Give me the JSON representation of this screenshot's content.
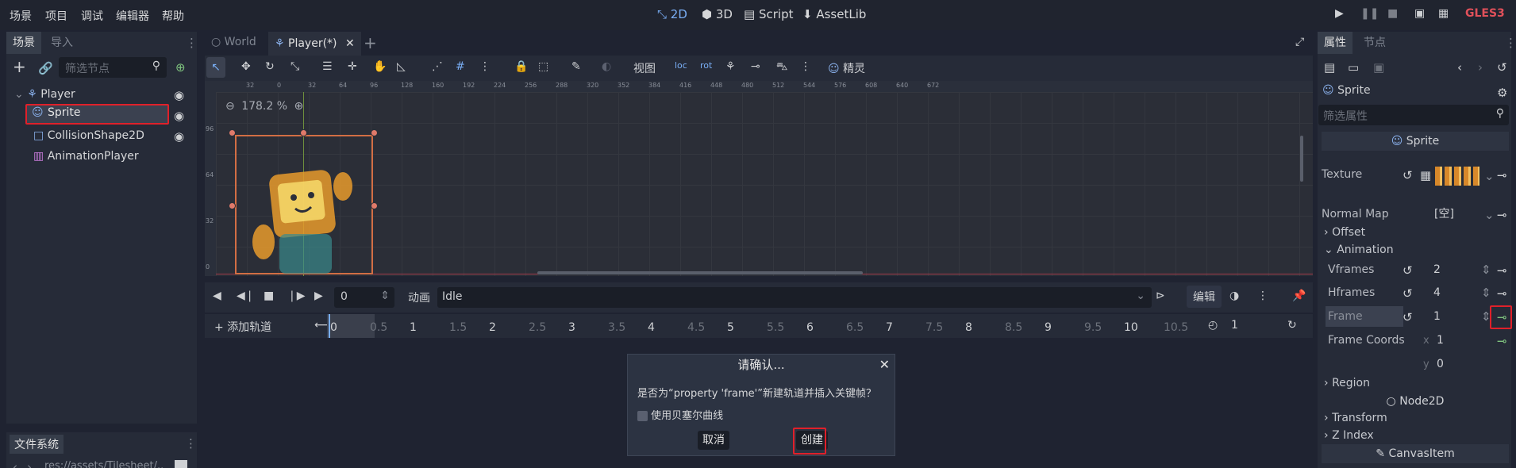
{
  "menu": [
    "场景",
    "项目",
    "调试",
    "编辑器",
    "帮助"
  ],
  "workspaces": {
    "w2d": "2D",
    "w3d": "3D",
    "script": "Script",
    "assetlib": "AssetLib"
  },
  "renderer": "GLES3",
  "scene_dock": {
    "tabs": [
      "场景",
      "导入"
    ],
    "filter_placeholder": "筛选节点",
    "nodes": [
      "Player",
      "Sprite",
      "CollisionShape2D",
      "AnimationPlayer"
    ]
  },
  "filesystem": {
    "tab": "文件系统",
    "path": "res://assets/Tilesheet/..."
  },
  "editor_tabs": [
    "World",
    "Player(*)"
  ],
  "toolbar": {
    "view": "视图",
    "sprite": "精灵"
  },
  "zoom": "178.2 %",
  "ruler_ticks": [
    "32",
    "0",
    "32",
    "64",
    "96",
    "128",
    "160",
    "192",
    "224",
    "256",
    "288",
    "320",
    "352",
    "384",
    "416",
    "448",
    "480",
    "512",
    "544",
    "576",
    "608",
    "640",
    "672"
  ],
  "ruler_v_ticks": [
    "96",
    "64",
    "32",
    "0"
  ],
  "animation_panel": {
    "frame_value": "0",
    "anim_label": "动画",
    "anim_name": "Idle",
    "edit_label": "编辑",
    "add_track": "添加轨道",
    "ticks": [
      "0",
      "0.5",
      "1",
      "1.5",
      "2",
      "2.5",
      "3",
      "3.5",
      "4",
      "4.5",
      "5",
      "5.5",
      "6",
      "6.5",
      "7",
      "7.5",
      "8",
      "8.5",
      "9",
      "9.5",
      "10",
      "10.5"
    ],
    "length": "1"
  },
  "inspector": {
    "tabs": [
      "属性",
      "节点"
    ],
    "object": "Sprite",
    "filter_placeholder": "筛选属性",
    "class_header": "Sprite",
    "texture_label": "Texture",
    "normal_map_label": "Normal Map",
    "normal_map_value": "[空]",
    "offset": "Offset",
    "animation": "Animation",
    "vframes_label": "Vframes",
    "vframes": "2",
    "hframes_label": "Hframes",
    "hframes": "4",
    "frame_label": "Frame",
    "frame": "1",
    "frame_coords_label": "Frame Coords",
    "fc_x_label": "x",
    "fc_x": "1",
    "fc_y_label": "y",
    "fc_y": "0",
    "region": "Region",
    "node2d": "Node2D",
    "transform": "Transform",
    "zindex": "Z Index",
    "canvasitem": "CanvasItem"
  },
  "dialog": {
    "title": "请确认...",
    "message": "是否为“property 'frame'”新建轨道并插入关键帧？",
    "checkbox": "使用贝塞尔曲线",
    "cancel": "取消",
    "create": "创建"
  }
}
